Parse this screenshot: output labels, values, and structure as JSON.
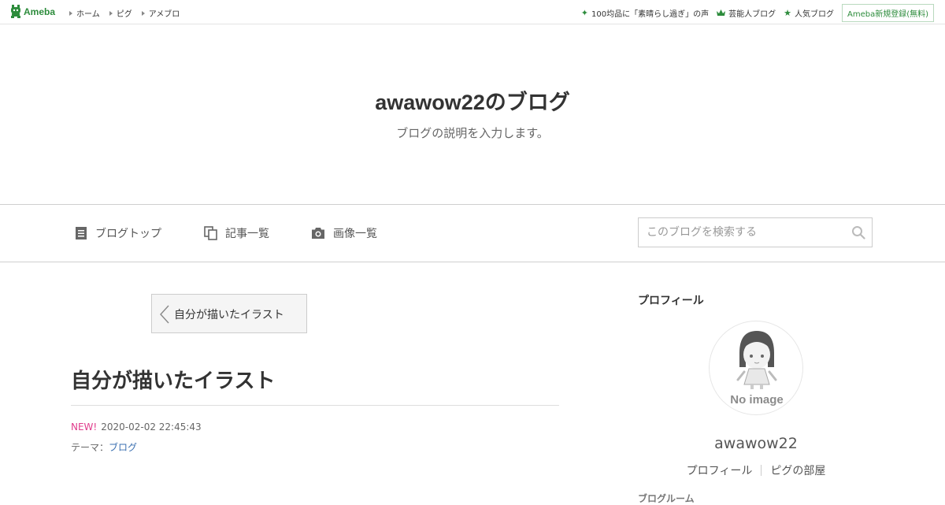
{
  "topbar": {
    "logo_text": "Ameba",
    "nav": [
      "ホーム",
      "ピグ",
      "アメブロ"
    ],
    "links": [
      {
        "icon": "sparkle-icon",
        "label": "100均品に「素晴らし過ぎ」の声"
      },
      {
        "icon": "crown-icon",
        "label": "芸能人ブログ"
      },
      {
        "icon": "star-icon",
        "label": "人気ブログ"
      }
    ],
    "signup_label": "Ameba新規登録(無料)",
    "accent_color": "#2d8c3c"
  },
  "header": {
    "title": "awawow22のブログ",
    "description": "ブログの説明を入力します。"
  },
  "nav": {
    "items": [
      {
        "icon": "document-icon",
        "label": "ブログトップ"
      },
      {
        "icon": "copy-icon",
        "label": "記事一覧"
      },
      {
        "icon": "camera-icon",
        "label": "画像一覧"
      }
    ],
    "search_placeholder": "このブログを検索する"
  },
  "entry": {
    "back_label": "自分が描いたイラスト",
    "title": "自分が描いたイラスト",
    "new_badge": "NEW!",
    "datetime": "2020-02-02 22:45:43",
    "theme_prefix": "テーマ：",
    "theme": "ブログ"
  },
  "sidebar": {
    "heading": "プロフィール",
    "avatar_text": "No image",
    "name": "awawow22",
    "links": [
      "プロフィール",
      "ピグの部屋"
    ],
    "next_heading": "ブログルーム"
  }
}
